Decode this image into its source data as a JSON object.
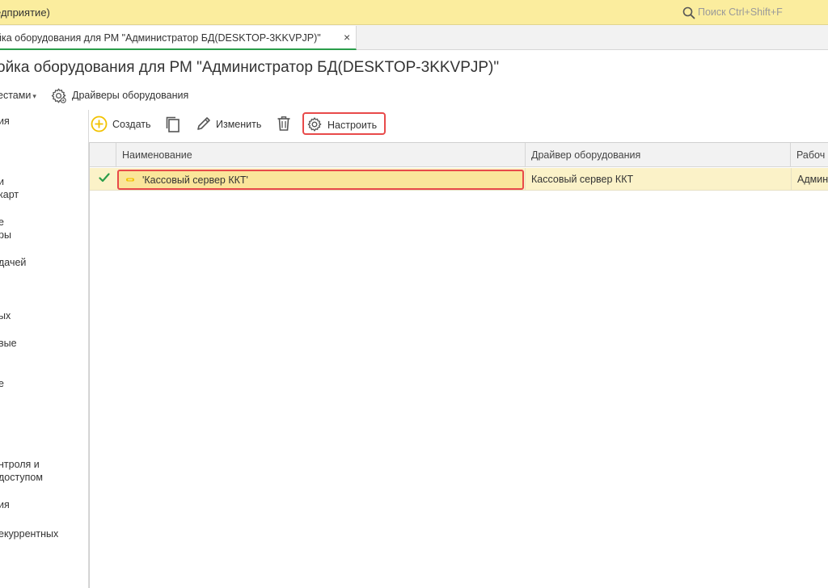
{
  "titlebar": {
    "app_title": "едприятие)",
    "search_placeholder": "Поиск Ctrl+Shift+F"
  },
  "tabs": [
    {
      "label": "йка оборудования для РМ \"Администратор БД(DESKTOP-3KKVPJP)\"",
      "close": "×"
    }
  ],
  "page": {
    "title": "ойка оборудования для РМ \"Администратор БД(DESKTOP-3KKVPJP)\""
  },
  "command_line": {
    "more_label": "естами",
    "more_caret": "▾",
    "drivers_label": "Драйверы оборудования"
  },
  "left_nav": {
    "items": [
      "ия",
      "и",
      "карт",
      "е",
      "ры",
      "дачей",
      "ых",
      "вые",
      "е",
      "нтроля и",
      "доступом",
      "ия",
      "екуррентных"
    ]
  },
  "toolbar": {
    "create_label": "Создать",
    "edit_label": "Изменить",
    "configure_label": "Настроить"
  },
  "table": {
    "columns": [
      "Наименование",
      "Драйвер оборудования",
      "Рабоч"
    ],
    "rows": [
      {
        "checked": true,
        "name": "'Кассовый сервер ККТ'",
        "driver": "Кассовый сервер ККТ",
        "workstation": "Админ"
      }
    ]
  },
  "colors": {
    "titlebar_bg": "#fbed9e",
    "selected_row_bg": "#fbf2c8",
    "highlight_border": "#e84a4a",
    "check_green": "#2a9d4a",
    "create_icon_yellow": "#f2c200"
  }
}
